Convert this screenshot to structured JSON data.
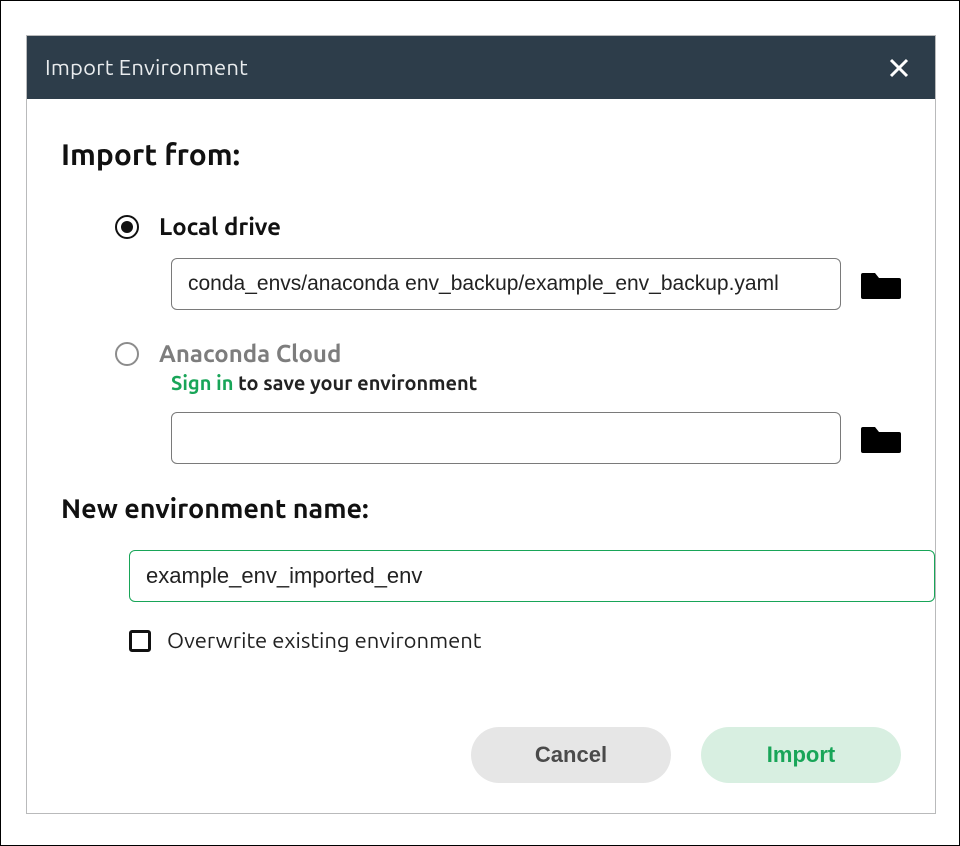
{
  "dialog": {
    "title": "Import Environment",
    "section_from": "Import from:",
    "local_drive_label": "Local drive",
    "local_drive_path": "conda_envs/anaconda env_backup/example_env_backup.yaml",
    "cloud_label": "Anaconda Cloud",
    "cloud_signin": "Sign in",
    "cloud_rest": " to save your environment",
    "cloud_path": "",
    "section_name": "New environment name:",
    "env_name": "example_env_imported_env",
    "overwrite_label": "Overwrite existing environment",
    "cancel": "Cancel",
    "import": "Import"
  }
}
